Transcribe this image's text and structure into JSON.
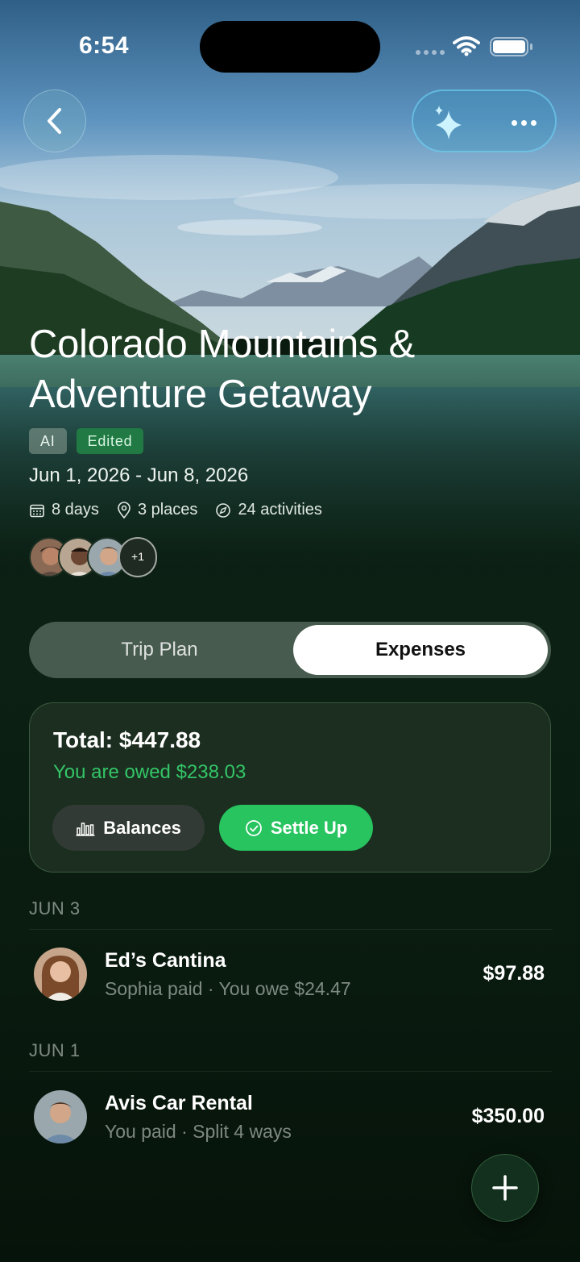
{
  "status_bar": {
    "time": "6:54"
  },
  "header": {
    "back_icon": "chevron-left-icon",
    "ai_icon": "sparkles-icon",
    "more_icon": "ellipsis-icon"
  },
  "trip": {
    "title": "Colorado Mountains & Adventure Getaway",
    "badges": [
      "AI",
      "Edited"
    ],
    "dates": "Jun 1, 2026 - Jun 8, 2026",
    "meta": [
      {
        "icon": "calendar-icon",
        "label": "8 days"
      },
      {
        "icon": "location-pin-icon",
        "label": "3 places"
      },
      {
        "icon": "compass-icon",
        "label": "24 activities"
      }
    ],
    "extra_members": "+1"
  },
  "tabs": {
    "trip_plan": "Trip Plan",
    "expenses": "Expenses",
    "selected": "Expenses"
  },
  "summary": {
    "total": "Total: $447.88",
    "owed": "You are owed $238.03",
    "balances_label": "Balances",
    "settle_label": "Settle Up"
  },
  "sections": [
    {
      "date": "JUN 3",
      "items": [
        {
          "title": "Ed’s Cantina",
          "subtitle": "Sophia paid · You owe $24.47",
          "amount": "$97.88"
        }
      ]
    },
    {
      "date": "JUN 1",
      "items": [
        {
          "title": "Avis Car Rental",
          "subtitle": "You paid · Split 4 ways",
          "amount": "$350.00"
        }
      ]
    }
  ],
  "fab": {
    "icon": "plus-icon"
  },
  "colors": {
    "accent_green": "#27c45f",
    "owed_green": "#34c567",
    "badge_edited": "#217a44"
  }
}
